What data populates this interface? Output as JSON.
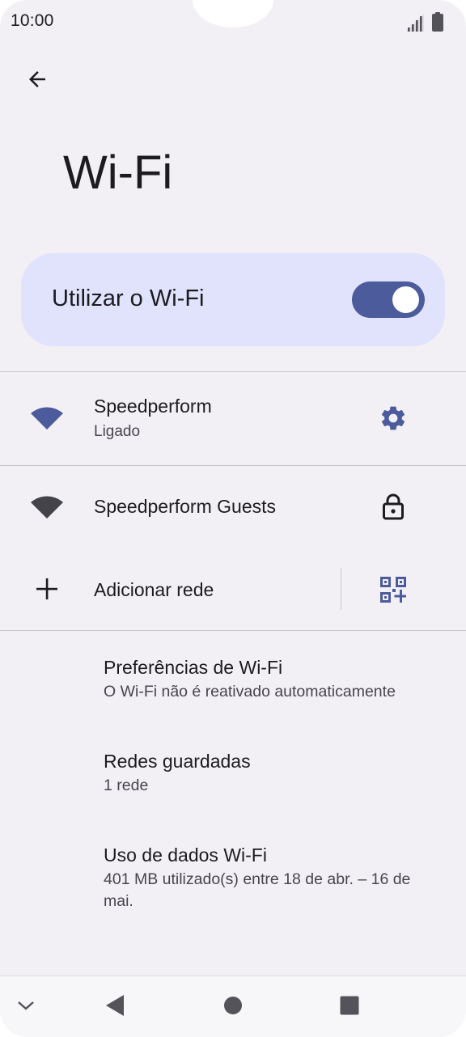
{
  "status_bar": {
    "time": "10:00"
  },
  "header": {
    "title": "Wi-Fi"
  },
  "toggle": {
    "label": "Utilizar o Wi-Fi",
    "state": "on"
  },
  "networks": [
    {
      "name": "Speedperform",
      "status": "Ligado",
      "trailing_icon": "gear-icon"
    },
    {
      "name": "Speedperform Guests",
      "trailing_icon": "lock-icon"
    }
  ],
  "add_network": {
    "label": "Adicionar rede"
  },
  "preferences": [
    {
      "title": "Preferências de Wi-Fi",
      "subtitle": "O Wi-Fi não é reativado automaticamente"
    },
    {
      "title": "Redes guardadas",
      "subtitle": "1 rede"
    },
    {
      "title": "Uso de dados Wi-Fi",
      "subtitle": "401 MB utilizado(s) entre 18 de abr. – 16 de mai."
    }
  ],
  "colors": {
    "accent": "#4c5b9b",
    "card": "#e1e3fc",
    "background": "#f2f0f4",
    "text": "#1c1b1f",
    "secondary_text": "#49454f"
  }
}
